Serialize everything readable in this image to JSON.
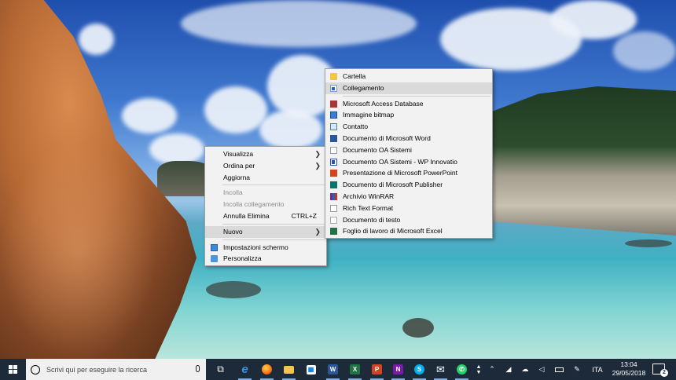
{
  "desktop_menu": {
    "items": [
      {
        "label": "Visualizza",
        "submenu": true
      },
      {
        "label": "Ordina per",
        "submenu": true
      },
      {
        "label": "Aggiorna"
      },
      {
        "label": "Incolla",
        "disabled": true
      },
      {
        "label": "Incolla collegamento",
        "disabled": true
      },
      {
        "label": "Annulla Elimina",
        "shortcut": "CTRL+Z"
      },
      {
        "label": "Nuovo",
        "submenu": true,
        "highlighted": true
      },
      {
        "label": "Impostazioni schermo",
        "icon": "display-settings-icon"
      },
      {
        "label": "Personalizza",
        "icon": "personalize-icon"
      }
    ]
  },
  "new_submenu": {
    "items": [
      {
        "label": "Cartella",
        "icon": "folder-icon"
      },
      {
        "label": "Collegamento",
        "icon": "shortcut-icon",
        "highlighted": true
      },
      {
        "label": "Microsoft Access Database",
        "icon": "access-icon"
      },
      {
        "label": "Immagine bitmap",
        "icon": "bitmap-icon"
      },
      {
        "label": "Contatto",
        "icon": "contact-icon"
      },
      {
        "label": "Documento di Microsoft Word",
        "icon": "word-icon"
      },
      {
        "label": "Documento OA Sistemi",
        "icon": "document-icon"
      },
      {
        "label": "Documento OA Sistemi - WP Innovatio",
        "icon": "document-word-icon"
      },
      {
        "label": "Presentazione di Microsoft PowerPoint",
        "icon": "powerpoint-icon"
      },
      {
        "label": "Documento di Microsoft Publisher",
        "icon": "publisher-icon"
      },
      {
        "label": "Archivio WinRAR",
        "icon": "winrar-icon"
      },
      {
        "label": "Rich Text Format",
        "icon": "rtf-icon"
      },
      {
        "label": "Documento di testo",
        "icon": "text-document-icon"
      },
      {
        "label": "Foglio di lavoro di Microsoft Excel",
        "icon": "excel-icon"
      }
    ]
  },
  "taskbar": {
    "search_placeholder": "Scrivi qui per eseguire la ricerca",
    "apps": [
      {
        "name": "task-view",
        "glyph": "⧉",
        "color": "transparent"
      },
      {
        "name": "edge",
        "glyph": "e",
        "color": "transparent",
        "fg": "#3a96dd"
      },
      {
        "name": "firefox",
        "glyph": "●",
        "color": "transparent",
        "fg": "#ff8a1c"
      },
      {
        "name": "file-explorer",
        "glyph": "▬",
        "color": "#f3c745"
      },
      {
        "name": "store",
        "glyph": "▣",
        "color": "transparent"
      },
      {
        "name": "word",
        "glyph": "W",
        "color": "#2b579a"
      },
      {
        "name": "excel",
        "glyph": "X",
        "color": "#217346"
      },
      {
        "name": "powerpoint",
        "glyph": "P",
        "color": "#d04423"
      },
      {
        "name": "onenote",
        "glyph": "N",
        "color": "#7719aa"
      },
      {
        "name": "skype",
        "glyph": "S",
        "color": "#00aff0"
      },
      {
        "name": "mail",
        "glyph": "✉",
        "color": "transparent"
      },
      {
        "name": "whatsapp",
        "glyph": "✆",
        "color": "#25d366"
      }
    ],
    "language": "ITA",
    "time": "13:04",
    "date": "29/05/2018",
    "notification_count": "2"
  }
}
